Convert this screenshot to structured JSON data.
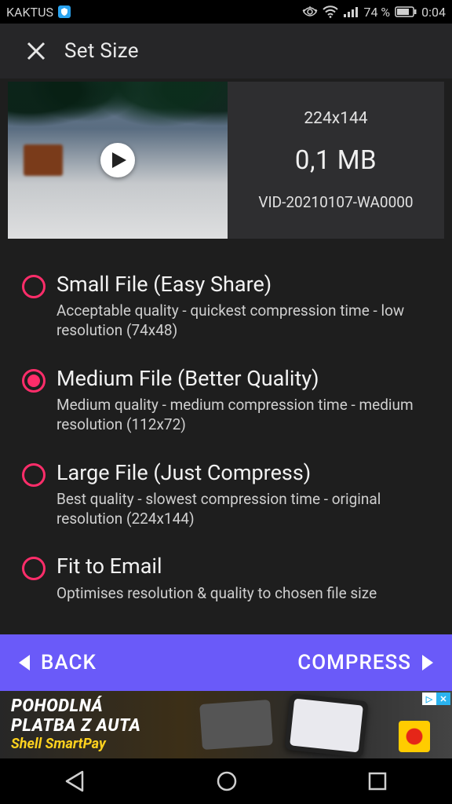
{
  "statusbar": {
    "carrier": "KAKTUS",
    "battery_pct": "74 %",
    "clock": "0:04"
  },
  "header": {
    "title": "Set Size"
  },
  "video": {
    "resolution": "224x144",
    "size": "0,1 MB",
    "filename": "VID-20210107-WA0000"
  },
  "options": [
    {
      "title": "Small File (Easy Share)",
      "desc": "Acceptable quality - quickest compression time - low resolution (74x48)",
      "selected": false
    },
    {
      "title": "Medium File (Better Quality)",
      "desc": "Medium quality - medium compression time - medium resolution (112x72)",
      "selected": true
    },
    {
      "title": "Large File (Just Compress)",
      "desc": "Best quality - slowest compression time - original resolution (224x144)",
      "selected": false
    },
    {
      "title": "Fit to Email",
      "desc": "Optimises resolution & quality to chosen file size",
      "selected": false
    }
  ],
  "bottombar": {
    "back": "BACK",
    "compress": "COMPRESS"
  },
  "ad": {
    "line1": "POHODLNÁ",
    "line2": "PLATBA Z AUTA",
    "line3": "Shell SmartPay"
  }
}
